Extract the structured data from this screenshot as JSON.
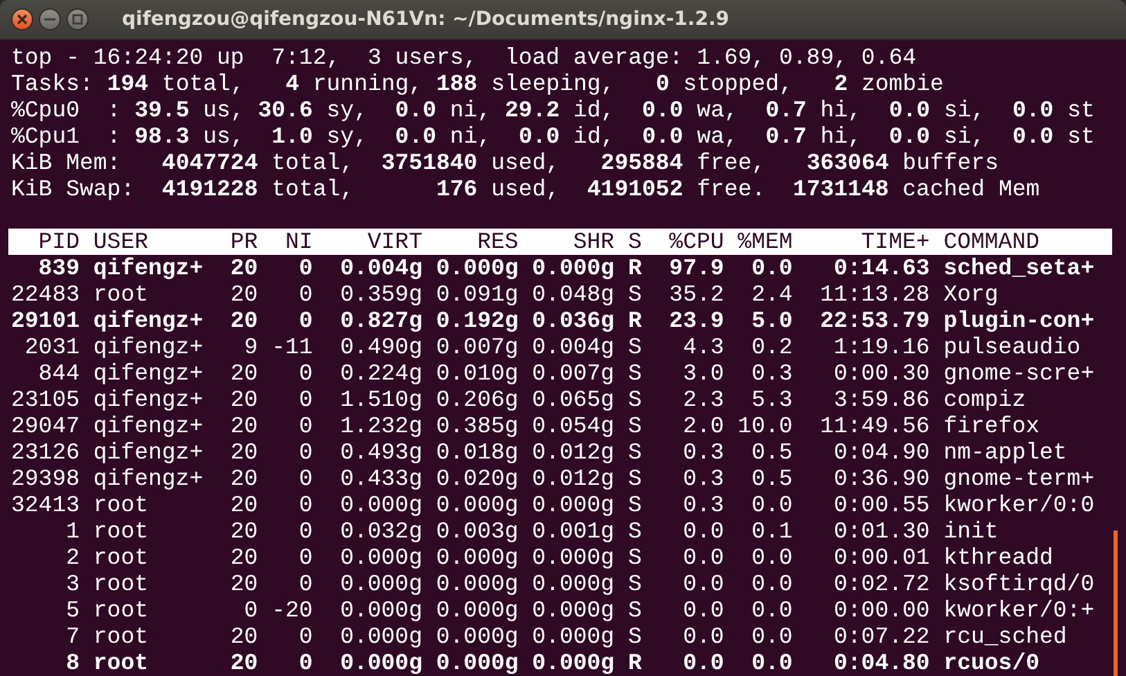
{
  "window": {
    "title": "qifengzou@qifengzou-N61Vn: ~/Documents/nginx-1.2.9"
  },
  "summary_lines": [
    "top - 16:24:20 up  7:12,  3 users,  load average: 1.69, 0.89, 0.64",
    "Tasks: **194** total,   **4** running, **188** sleeping,   **0** stopped,   **2** zombie",
    "%Cpu0  : **39.5** us, **30.6** sy,  **0.0** ni, **29.2** id,  **0.0** wa,  **0.7** hi,  **0.0** si,  **0.0** st",
    "%Cpu1  : **98.3** us,  **1.0** sy,  **0.0** ni,  **0.0** id,  **0.0** wa,  **0.7** hi,  **0.0** si,  **0.0** st",
    "KiB Mem:   **4047724** total,  **3751840** used,   **295884** free,   **363064** buffers",
    "KiB Swap:  **4191228** total,      **176** used,  **4191052** free.  **1731148** cached Mem"
  ],
  "table": {
    "columns": [
      "PID",
      "USER",
      "PR",
      "NI",
      "VIRT",
      "RES",
      "SHR",
      "S",
      "%CPU",
      "%MEM",
      "TIME+",
      "COMMAND"
    ],
    "rows": [
      {
        "highlighted": true,
        "cells": [
          "839",
          "qifengz+",
          "20",
          "0",
          "0.004g",
          "0.000g",
          "0.000g",
          "R",
          "97.9",
          "0.0",
          "0:14.63",
          "sched_seta+"
        ]
      },
      {
        "highlighted": false,
        "cells": [
          "22483",
          "root",
          "20",
          "0",
          "0.359g",
          "0.091g",
          "0.048g",
          "S",
          "35.2",
          "2.4",
          "11:13.28",
          "Xorg"
        ]
      },
      {
        "highlighted": true,
        "cells": [
          "29101",
          "qifengz+",
          "20",
          "0",
          "0.827g",
          "0.192g",
          "0.036g",
          "R",
          "23.9",
          "5.0",
          "22:53.79",
          "plugin-con+"
        ]
      },
      {
        "highlighted": false,
        "cells": [
          "2031",
          "qifengz+",
          "9",
          "-11",
          "0.490g",
          "0.007g",
          "0.004g",
          "S",
          "4.3",
          "0.2",
          "1:19.16",
          "pulseaudio"
        ]
      },
      {
        "highlighted": false,
        "cells": [
          "844",
          "qifengz+",
          "20",
          "0",
          "0.224g",
          "0.010g",
          "0.007g",
          "S",
          "3.0",
          "0.3",
          "0:00.30",
          "gnome-scre+"
        ]
      },
      {
        "highlighted": false,
        "cells": [
          "23105",
          "qifengz+",
          "20",
          "0",
          "1.510g",
          "0.206g",
          "0.065g",
          "S",
          "2.3",
          "5.3",
          "3:59.86",
          "compiz"
        ]
      },
      {
        "highlighted": false,
        "cells": [
          "29047",
          "qifengz+",
          "20",
          "0",
          "1.232g",
          "0.385g",
          "0.054g",
          "S",
          "2.0",
          "10.0",
          "11:49.56",
          "firefox"
        ]
      },
      {
        "highlighted": false,
        "cells": [
          "23126",
          "qifengz+",
          "20",
          "0",
          "0.493g",
          "0.018g",
          "0.012g",
          "S",
          "0.3",
          "0.5",
          "0:04.90",
          "nm-applet"
        ]
      },
      {
        "highlighted": false,
        "cells": [
          "29398",
          "qifengz+",
          "20",
          "0",
          "0.433g",
          "0.020g",
          "0.012g",
          "S",
          "0.3",
          "0.5",
          "0:36.90",
          "gnome-term+"
        ]
      },
      {
        "highlighted": false,
        "cells": [
          "32413",
          "root",
          "20",
          "0",
          "0.000g",
          "0.000g",
          "0.000g",
          "S",
          "0.3",
          "0.0",
          "0:00.55",
          "kworker/0:0"
        ]
      },
      {
        "highlighted": false,
        "cells": [
          "1",
          "root",
          "20",
          "0",
          "0.032g",
          "0.003g",
          "0.001g",
          "S",
          "0.0",
          "0.1",
          "0:01.30",
          "init"
        ]
      },
      {
        "highlighted": false,
        "cells": [
          "2",
          "root",
          "20",
          "0",
          "0.000g",
          "0.000g",
          "0.000g",
          "S",
          "0.0",
          "0.0",
          "0:00.01",
          "kthreadd"
        ]
      },
      {
        "highlighted": false,
        "cells": [
          "3",
          "root",
          "20",
          "0",
          "0.000g",
          "0.000g",
          "0.000g",
          "S",
          "0.0",
          "0.0",
          "0:02.72",
          "ksoftirqd/0"
        ]
      },
      {
        "highlighted": false,
        "cells": [
          "5",
          "root",
          "0",
          "-20",
          "0.000g",
          "0.000g",
          "0.000g",
          "S",
          "0.0",
          "0.0",
          "0:00.00",
          "kworker/0:+"
        ]
      },
      {
        "highlighted": false,
        "cells": [
          "7",
          "root",
          "20",
          "0",
          "0.000g",
          "0.000g",
          "0.000g",
          "S",
          "0.0",
          "0.0",
          "0:07.22",
          "rcu_sched"
        ]
      },
      {
        "highlighted": true,
        "cells": [
          "8",
          "root",
          "20",
          "0",
          "0.000g",
          "0.000g",
          "0.000g",
          "R",
          "0.0",
          "0.0",
          "0:04.80",
          "rcuos/0"
        ]
      }
    ]
  }
}
